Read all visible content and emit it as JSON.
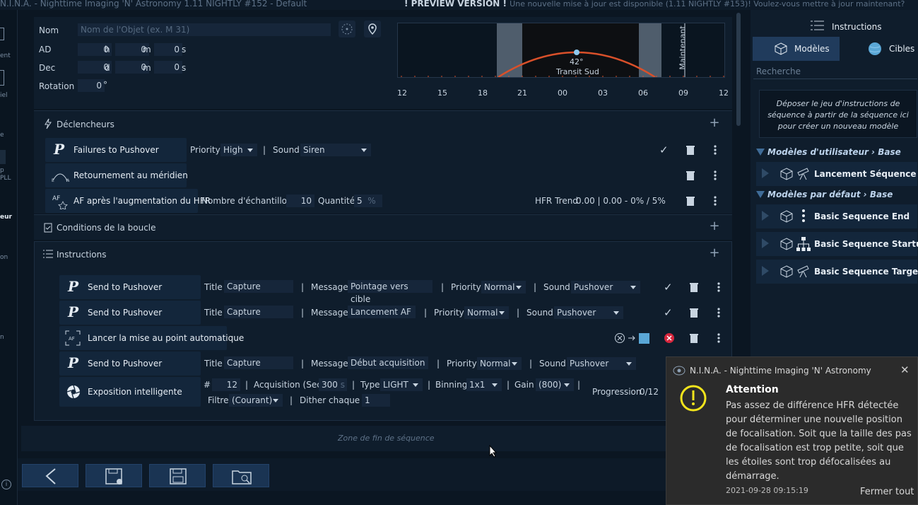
{
  "window": {
    "title": "N.I.N.A. - Nighttime Imaging 'N' Astronomy 1.11 NIGHTLY #152  -  Default",
    "preview": "! PREVIEW VERSION !",
    "update_msg": "Une nouvelle mise à jour est disponible (1.11 NIGHTLY #153)! Voulez-vous mettre à jour maintenant?"
  },
  "sidebar_fragments": [
    "ent",
    "iel",
    "e",
    "p",
    "PLL",
    "eur",
    "on",
    "n"
  ],
  "target": {
    "name_label": "Nom",
    "name_placeholder": "Nom de l'Objet (ex. M 31)",
    "ra_label": "AD",
    "ra": {
      "h": "0",
      "m": "0",
      "s": "0"
    },
    "dec_label": "Dec",
    "dec": {
      "d": "0",
      "m": "0",
      "s": "0"
    },
    "rotation_label": "Rotation",
    "rotation": "0",
    "units": {
      "h": "h",
      "m": "m",
      "s": "s",
      "d": "d",
      "deg": "°"
    }
  },
  "altitude_chart": {
    "max_alt": "42°",
    "transit": "Transit Sud",
    "now_label": "Maintenant",
    "ticks": [
      "12",
      "15",
      "18",
      "21",
      "00",
      "03",
      "06",
      "09",
      "12"
    ]
  },
  "triggers": {
    "title": "Déclencheurs",
    "items": [
      {
        "label": "Failures to Pushover",
        "priority_label": "Priority",
        "priority": "High",
        "sound_label": "Sound",
        "sound": "Siren"
      },
      {
        "label": "Retournement au méridien"
      },
      {
        "label": "AF après l'augmentation du HFR",
        "samples_label": "Nombre d'échantillon",
        "samples": "10",
        "qty_label": "Quantité",
        "qty": "5",
        "qty_unit": "%",
        "trend_label": "HFR Trend",
        "trend_value": "0.00 | 0.00 - 0% / 5%"
      }
    ]
  },
  "loop_conditions": {
    "title": "Conditions de la boucle"
  },
  "instructions": {
    "title": "Instructions",
    "items": [
      {
        "label": "Send to Pushover",
        "title_label": "Title",
        "title": "Capture",
        "message_label": "Message",
        "message": "Pointage vers cible",
        "priority_label": "Priority",
        "priority": "Normal",
        "sound_label": "Sound",
        "sound": "Pushover"
      },
      {
        "label": "Send to Pushover",
        "title_label": "Title",
        "title": "Capture",
        "message_label": "Message",
        "message": "Lancement AF",
        "priority_label": "Priority",
        "priority": "Normal",
        "sound_label": "Sound",
        "sound": "Pushover"
      },
      {
        "label": "Lancer la mise au point automatique"
      },
      {
        "label": "Send to Pushover",
        "title_label": "Title",
        "title": "Capture",
        "message_label": "Message",
        "message": "Début acquisition",
        "priority_label": "Priority",
        "priority": "Normal",
        "sound_label": "Sound",
        "sound": "Pushover"
      },
      {
        "label": "Exposition intelligente",
        "count_label": "#",
        "count": "12",
        "exposure_label": "Acquisition (Sec)",
        "exposure": "300",
        "exposure_unit": "s",
        "type_label": "Type",
        "type": "LIGHT",
        "binning_label": "Binning",
        "binning": "1x1",
        "gain_label": "Gain",
        "gain": "(800)",
        "filter_label": "Filtre",
        "filter": "(Courant)",
        "dither_label": "Dither chaque #",
        "dither": "1",
        "progress_label": "Progression",
        "progress": "0/12"
      }
    ]
  },
  "end_zone": "Zone de fin de séquence",
  "right_panel": {
    "instructions_tab": "Instructions",
    "models_tab": "Modèles",
    "targets_tab": "Cibles",
    "search_placeholder": "Recherche",
    "drop_hint": "Déposer le jeu d'instructions de séquence à partir de la séquence ici pour créer un nouveau modèle",
    "user_group": "Modèles d'utilisateur › Base",
    "user_items": [
      "Lancement Séquence"
    ],
    "default_group": "Modèles par défaut › Base",
    "default_items": [
      "Basic Sequence End",
      "Basic Sequence Startup",
      "Basic Sequence Target"
    ]
  },
  "toast": {
    "app": "N.I.N.A. - Nighttime Imaging 'N' Astronomy",
    "title": "Attention",
    "message": "Pas assez de différence HFR détectée pour déterminer une nouvelle position de focalisation. Soit que la taille des pas de focalisation est trop petite, soit que les étoiles sont trop défocalisées au démarrage.",
    "timestamp": "2021-09-28 09:15:19",
    "close_all": "Fermer tout"
  },
  "colors": {
    "accent": "#5aa7d6",
    "curve": "#d9502a",
    "bg": "#0b1622",
    "panel": "#0f1d2c",
    "item": "#13263b",
    "warn": "#f2e41c",
    "error": "#d7263d"
  }
}
